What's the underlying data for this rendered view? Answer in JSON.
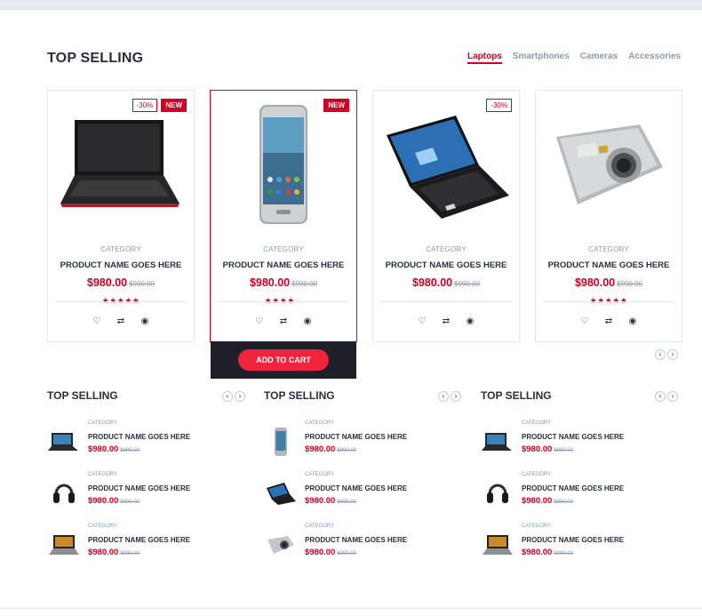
{
  "section": {
    "title": "TOP SELLING"
  },
  "tabs": [
    {
      "label": "Laptops",
      "active": true
    },
    {
      "label": "Smartphones",
      "active": false
    },
    {
      "label": "Cameras",
      "active": false
    },
    {
      "label": "Accessories",
      "active": false
    }
  ],
  "products": [
    {
      "image": "laptop-dark-red",
      "sale": "-30%",
      "new": "NEW",
      "category": "CATEGORY",
      "name": "PRODUCT NAME GOES HERE",
      "price": "$980.00",
      "old_price": "$990.00",
      "rating": 5
    },
    {
      "image": "smartphone",
      "sale": "",
      "new": "NEW",
      "category": "CATEGORY",
      "name": "PRODUCT NAME GOES HERE",
      "price": "$980.00",
      "old_price": "$990.00",
      "rating": 4
    },
    {
      "image": "laptop-windows",
      "sale": "-30%",
      "new": "",
      "category": "CATEGORY",
      "name": "PRODUCT NAME GOES HERE",
      "price": "$980.00",
      "old_price": "$990.00",
      "rating": 0
    },
    {
      "image": "digital-camera",
      "sale": "",
      "new": "",
      "category": "CATEGORY",
      "name": "PRODUCT NAME GOES HERE",
      "price": "$980.00",
      "old_price": "$990.00",
      "rating": 5
    }
  ],
  "product_actions": {
    "wishlist": "heart-icon",
    "compare": "exchange-icon",
    "quickview": "eye-icon"
  },
  "add_to_cart": "ADD TO CART",
  "widgets": [
    {
      "title": "TOP SELLING",
      "items": [
        {
          "image": "laptop-small",
          "category": "CATEGORY",
          "name": "PRODUCT NAME GOES HERE",
          "price": "$980.00",
          "old_price": "$990.00"
        },
        {
          "image": "headphones",
          "category": "CATEGORY",
          "name": "PRODUCT NAME GOES HERE",
          "price": "$980.00",
          "old_price": "$990.00"
        },
        {
          "image": "laptop-open",
          "category": "CATEGORY",
          "name": "PRODUCT NAME GOES HERE",
          "price": "$980.00",
          "old_price": "$990.00"
        }
      ]
    },
    {
      "title": "TOP SELLING",
      "items": [
        {
          "image": "smartphone-small",
          "category": "CATEGORY",
          "name": "PRODUCT NAME GOES HERE",
          "price": "$980.00",
          "old_price": "$990.00"
        },
        {
          "image": "laptop-windows-small",
          "category": "CATEGORY",
          "name": "PRODUCT NAME GOES HERE",
          "price": "$980.00",
          "old_price": "$990.00"
        },
        {
          "image": "camera-small",
          "category": "CATEGORY",
          "name": "PRODUCT NAME GOES HERE",
          "price": "$980.00",
          "old_price": "$990.00"
        }
      ]
    },
    {
      "title": "TOP SELLING",
      "items": [
        {
          "image": "laptop-small",
          "category": "CATEGORY",
          "name": "PRODUCT NAME GOES HERE",
          "price": "$980.00",
          "old_price": "$990.00"
        },
        {
          "image": "headphones",
          "category": "CATEGORY",
          "name": "PRODUCT NAME GOES HERE",
          "price": "$980.00",
          "old_price": "$990.00"
        },
        {
          "image": "laptop-open",
          "category": "CATEGORY",
          "name": "PRODUCT NAME GOES HERE",
          "price": "$980.00",
          "old_price": "$990.00"
        }
      ]
    }
  ],
  "colors": {
    "accent": "#d10024",
    "button": "#ef233c",
    "dark": "#1e1f29",
    "text": "#2b2d42",
    "muted": "#8d99ae"
  }
}
